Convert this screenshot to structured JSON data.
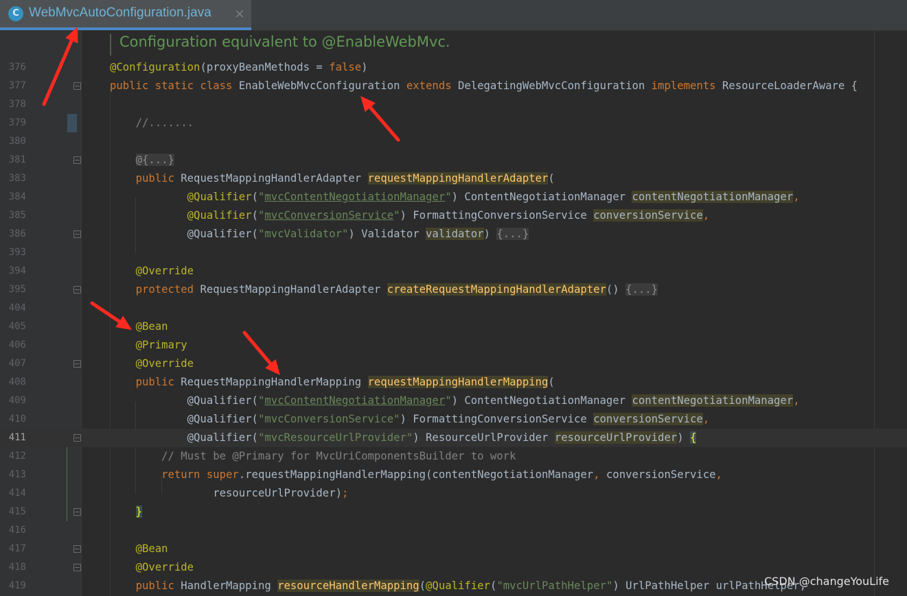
{
  "tab": {
    "icon_letter": "C",
    "icon": "java-class-icon",
    "title": "WebMvcAutoConfiguration.java",
    "close": "×"
  },
  "doc_comment": "Configuration equivalent to @EnableWebMvc.",
  "lines": [
    {
      "num": "376",
      "segments": [
        {
          "text": "@Configuration",
          "cls": "an"
        },
        {
          "text": "(proxyBeanMethods = "
        },
        {
          "text": "false",
          "cls": "kw"
        },
        {
          "text": ")"
        }
      ]
    },
    {
      "num": "377",
      "segments": [
        {
          "text": "public static class ",
          "cls": "kw"
        },
        {
          "text": "EnableWebMvcConfiguration "
        },
        {
          "text": "extends ",
          "cls": "kw"
        },
        {
          "text": "DelegatingWebMvcConfiguration "
        },
        {
          "text": "implements ",
          "cls": "kw"
        },
        {
          "text": "ResourceLoaderAware {"
        }
      ]
    },
    {
      "num": "378",
      "segments": []
    },
    {
      "num": "379",
      "segments": [
        {
          "text": "    "
        },
        {
          "text": "//.......",
          "cls": "cm"
        }
      ]
    },
    {
      "num": "380",
      "segments": []
    },
    {
      "num": "381",
      "segments": [
        {
          "text": "    "
        },
        {
          "text": "@{...}",
          "cls": "fc"
        }
      ]
    },
    {
      "num": "383",
      "segments": [
        {
          "text": "    "
        },
        {
          "text": "public ",
          "cls": "kw"
        },
        {
          "text": "RequestMappingHandlerAdapter "
        },
        {
          "text": "requestMappingHandlerAdapter",
          "cls": "hl-y"
        },
        {
          "text": "("
        }
      ]
    },
    {
      "num": "384",
      "segments": [
        {
          "text": "            "
        },
        {
          "text": "@Qualifier",
          "cls": "an"
        },
        {
          "text": "("
        },
        {
          "text": "\"",
          "cls": "st"
        },
        {
          "text": "mvcContentNegotiationManager",
          "cls": "stu"
        },
        {
          "text": "\"",
          "cls": "st"
        },
        {
          "text": ") ContentNegotiationManager "
        },
        {
          "text": "contentNegotiationManager",
          "cls": "hl"
        },
        {
          "text": ",",
          "cls": "kw"
        }
      ]
    },
    {
      "num": "385",
      "segments": [
        {
          "text": "            "
        },
        {
          "text": "@Qualifier",
          "cls": "an"
        },
        {
          "text": "("
        },
        {
          "text": "\"",
          "cls": "st"
        },
        {
          "text": "mvcConversionService",
          "cls": "stu"
        },
        {
          "text": "\"",
          "cls": "st"
        },
        {
          "text": ") FormattingConversionService "
        },
        {
          "text": "conversionService",
          "cls": "hl"
        },
        {
          "text": ",",
          "cls": "kw"
        }
      ]
    },
    {
      "num": "386",
      "segments": [
        {
          "text": "            @Qualifier("
        },
        {
          "text": "\"mvcValidator\"",
          "cls": "st"
        },
        {
          "text": ") Validator "
        },
        {
          "text": "validator",
          "cls": "hl"
        },
        {
          "text": ") "
        },
        {
          "text": "{...}",
          "cls": "fc"
        }
      ]
    },
    {
      "num": "393",
      "segments": []
    },
    {
      "num": "394",
      "segments": [
        {
          "text": "    "
        },
        {
          "text": "@Override",
          "cls": "an"
        }
      ]
    },
    {
      "num": "395",
      "segments": [
        {
          "text": "    "
        },
        {
          "text": "protected ",
          "cls": "kw"
        },
        {
          "text": "RequestMappingHandlerAdapter "
        },
        {
          "text": "createRequestMappingHandlerAdapter",
          "cls": "hl-y"
        },
        {
          "text": "() "
        },
        {
          "text": "{...}",
          "cls": "fc"
        }
      ]
    },
    {
      "num": "404",
      "segments": []
    },
    {
      "num": "405",
      "segments": [
        {
          "text": "    "
        },
        {
          "text": "@Bean",
          "cls": "an"
        }
      ]
    },
    {
      "num": "406",
      "segments": [
        {
          "text": "    "
        },
        {
          "text": "@Primary",
          "cls": "an"
        }
      ]
    },
    {
      "num": "407",
      "segments": [
        {
          "text": "    "
        },
        {
          "text": "@Override",
          "cls": "an"
        }
      ]
    },
    {
      "num": "408",
      "segments": [
        {
          "text": "    "
        },
        {
          "text": "public ",
          "cls": "kw"
        },
        {
          "text": "RequestMappingHandlerMapping "
        },
        {
          "text": "requestMappingHandlerMapping",
          "cls": "hl-y"
        },
        {
          "text": "("
        }
      ]
    },
    {
      "num": "409",
      "segments": [
        {
          "text": "            @Qualifier("
        },
        {
          "text": "\"",
          "cls": "st"
        },
        {
          "text": "mvcContentNegotiationManager",
          "cls": "stu"
        },
        {
          "text": "\"",
          "cls": "st"
        },
        {
          "text": ") ContentNegotiationManager "
        },
        {
          "text": "contentNegotiationManager",
          "cls": "hl"
        },
        {
          "text": ",",
          "cls": "kw"
        }
      ]
    },
    {
      "num": "410",
      "segments": [
        {
          "text": "            @Qualifier("
        },
        {
          "text": "\"mvcConversionService\"",
          "cls": "st"
        },
        {
          "text": ") FormattingConversionService "
        },
        {
          "text": "conversionService",
          "cls": "hl"
        },
        {
          "text": ",",
          "cls": "kw"
        }
      ]
    },
    {
      "num": "411",
      "segments": [
        {
          "text": "            @Qualifier("
        },
        {
          "text": "\"mvcResourceUrlProvider\"",
          "cls": "st"
        },
        {
          "text": ") ResourceUrlProvider "
        },
        {
          "text": "resourceUrlProvider",
          "cls": "hl"
        },
        {
          "text": ") "
        },
        {
          "text": "{",
          "cls": "bmatch"
        }
      ],
      "current": true
    },
    {
      "num": "412",
      "segments": [
        {
          "text": "        "
        },
        {
          "text": "// Must be @Primary for MvcUriComponentsBuilder to work",
          "cls": "cm"
        }
      ]
    },
    {
      "num": "413",
      "segments": [
        {
          "text": "        "
        },
        {
          "text": "return super",
          "cls": "kw"
        },
        {
          "text": ".requestMappingHandlerMapping(contentNegotiationManager"
        },
        {
          "text": ", ",
          "cls": "kw"
        },
        {
          "text": "conversionService"
        },
        {
          "text": ",",
          "cls": "kw"
        }
      ]
    },
    {
      "num": "414",
      "segments": [
        {
          "text": "                resourceUrlProvider)"
        },
        {
          "text": ";",
          "cls": "kw"
        }
      ]
    },
    {
      "num": "415",
      "segments": [
        {
          "text": "    "
        },
        {
          "text": "}",
          "cls": "bmatch"
        }
      ]
    },
    {
      "num": "416",
      "segments": []
    },
    {
      "num": "417",
      "segments": [
        {
          "text": "    "
        },
        {
          "text": "@Bean",
          "cls": "an"
        }
      ]
    },
    {
      "num": "418",
      "segments": [
        {
          "text": "    "
        },
        {
          "text": "@Override",
          "cls": "an"
        }
      ]
    },
    {
      "num": "419",
      "segments": [
        {
          "text": "    "
        },
        {
          "text": "public ",
          "cls": "kw"
        },
        {
          "text": "HandlerMapping "
        },
        {
          "text": "resourceHandlerMapping",
          "cls": "hl-y"
        },
        {
          "text": "("
        },
        {
          "text": "@Qualifier",
          "cls": "an"
        },
        {
          "text": "("
        },
        {
          "text": "\"mvcUrlPathHelper\"",
          "cls": "st"
        },
        {
          "text": ") UrlPathHelper urlPathHelper,"
        }
      ]
    }
  ],
  "annotation_color": "#ff2a1f",
  "watermark": "CSDN @changeYouLife"
}
